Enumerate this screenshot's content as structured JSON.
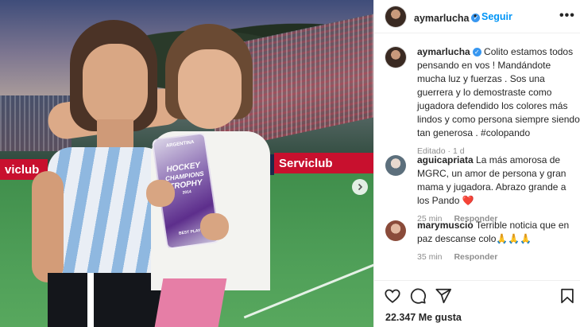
{
  "photo": {
    "alt_board_left": "viclub",
    "alt_board_right": "Serviclub",
    "trophy_lines": [
      "ARGENTINA",
      "HOCKEY",
      "CHAMPIONS",
      "TROPHY",
      "2014",
      "BEST PLAYER"
    ]
  },
  "header": {
    "username": "aymarlucha",
    "separator": "•",
    "follow_label": "Seguir",
    "more_label": "•••"
  },
  "caption": {
    "username": "aymarlucha",
    "text": "Colito estamos todos pensando en vos ! Mandándote mucha luz y fuerzas . Sos una guerrera y lo demostraste como jugadora defendido los colores más lindos y como persona siempre siendo tan generosa . #colopando",
    "meta_edited": "Editado · 1 d"
  },
  "comments": [
    {
      "username": "aguicapriata",
      "text": "La más amorosa de MGRC, un amor de persona y gran mama y jugadora. Abrazo grande a los Pando",
      "emoji": "❤️",
      "time": "25 min",
      "reply_label": "Responder"
    },
    {
      "username": "marymuscio",
      "text": "Terrible noticia que en paz descanse colo",
      "emoji": "🙏🙏🙏",
      "time": "35 min",
      "reply_label": "Responder"
    }
  ],
  "actions": {
    "likes": "22.347 Me gusta",
    "icons": [
      "heart-icon",
      "comment-icon",
      "share-icon",
      "bookmark-icon"
    ]
  },
  "colors": {
    "accent": "#0095f6",
    "verified": "#3897f0",
    "heart_red": "#ed4956"
  }
}
